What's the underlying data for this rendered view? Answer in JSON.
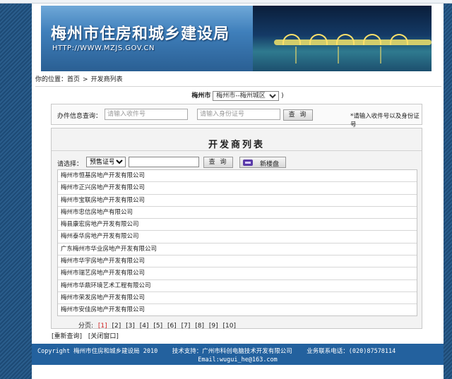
{
  "banner": {
    "title": "梅州市住房和城乡建设局",
    "url": "HTTP://WWW.MZJS.GOV.CN"
  },
  "breadcrumb": {
    "prefix": "你的位置：",
    "home": "首页",
    "separator": ">",
    "current": "开发商列表"
  },
  "city": {
    "label": "梅州市",
    "selected": "梅州市--梅州城区",
    "suffix": ")"
  },
  "query": {
    "label": "办件信息查询：",
    "receipt_placeholder": "请输入收件号",
    "separator": "、",
    "id_placeholder": "请输入身份证号",
    "button": "查 询",
    "hint": "*请输入收件号以及身份证号"
  },
  "panel": {
    "title": "开发商列表",
    "filter_label": "请选择：",
    "filter_selected": "预售证号",
    "search_button": "查 询",
    "new_button": "新楼盘"
  },
  "developers": [
    "梅州市恒基房地产开发有限公司",
    "梅州市正兴房地产开发有限公司",
    "梅州市宝联房地产开发有限公司",
    "梅州市忠信房地产有限公司",
    "梅县康宏房地产开发有限公司",
    "梅州泰华房地产开发有限公司",
    "广东梅州市华业房地产开发有限公司",
    "梅州市华宇房地产开发有限公司",
    "梅州市瑞艺房地产开发有限公司",
    "梅州市华鼎环境艺术工程有限公司",
    "梅州市荣发房地产开发有限公司",
    "梅州市安佳房地产开发有限公司"
  ],
  "pager": {
    "label": "分页:",
    "pages": [
      "[1]",
      "[2]",
      "[3]",
      "[4]",
      "[5]",
      "[6]",
      "[7]",
      "[8]",
      "[9]",
      "[10]"
    ],
    "current_index": 0
  },
  "links": {
    "requery": "[重新查询]",
    "close": "[关闭窗口]"
  },
  "footer": {
    "copyright": "Copyright 梅州市住房和城乡建设局 2010",
    "support": "技术支持：广州市科创电脑技术开发有限公司",
    "phone": "业务联系电话：(020)87578114",
    "email": "Email:wugui_he@163.com"
  },
  "colors": {
    "accent": "#23619e",
    "current_page": "#d02020"
  }
}
